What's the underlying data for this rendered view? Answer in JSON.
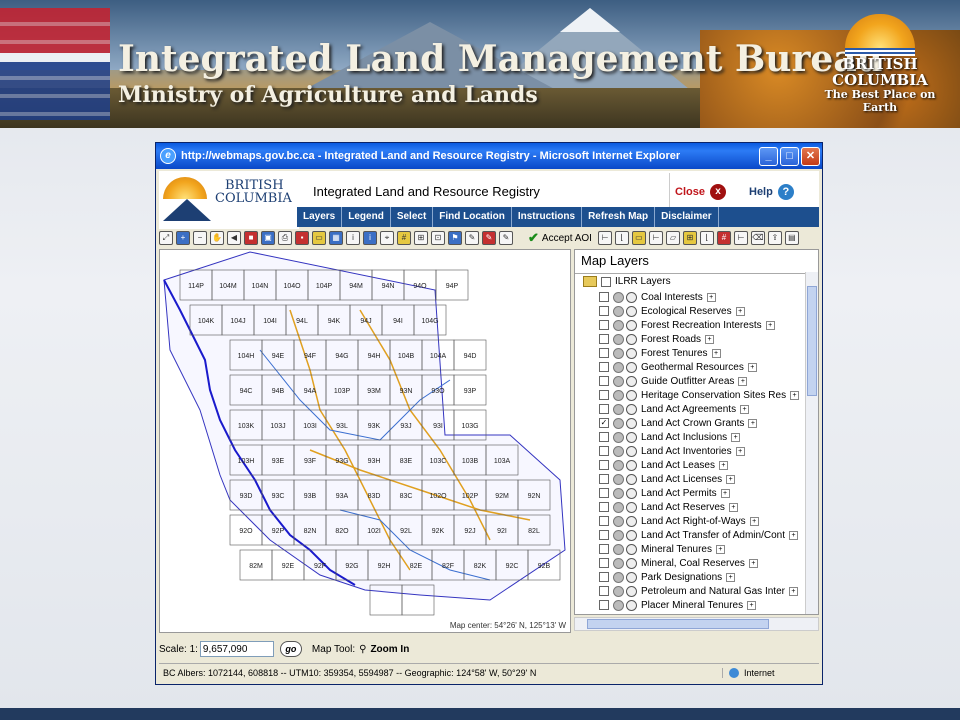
{
  "banner": {
    "title": "Integrated Land Management Bureau",
    "subtitle": "Ministry of Agriculture and Lands",
    "logo_line1": "BRITISH",
    "logo_line2": "COLUMBIA",
    "logo_tagline": "The Best Place on Earth"
  },
  "browser": {
    "title": "http://webmaps.gov.bc.ca - Integrated Land and Resource Registry - Microsoft Internet Explorer",
    "min": "_",
    "max": "□",
    "close": "✕"
  },
  "app": {
    "logo_line1": "BRITISH",
    "logo_line2": "COLUMBIA",
    "title": "Integrated Land and Resource Registry",
    "close_label": "Close",
    "help_label": "Help",
    "menu": [
      "Layers",
      "Legend",
      "Select",
      "Find Location",
      "Instructions",
      "Refresh Map",
      "Disclaimer"
    ]
  },
  "toolbar": {
    "accept_label": "Accept AOI"
  },
  "map": {
    "center_label": "Map center: 54°26' N, 125°13' W",
    "tiles": [
      "114P",
      "104M",
      "104N",
      "104O",
      "104P",
      "94M",
      "94N",
      "94O",
      "94P",
      "104K",
      "104J",
      "104I",
      "94L",
      "94K",
      "94J",
      "94I",
      "104G",
      "104H",
      "94E",
      "94F",
      "94G",
      "94H",
      "104B",
      "104A",
      "94D",
      "94C",
      "94B",
      "94A",
      "103P",
      "93M",
      "93N",
      "93O",
      "93P",
      "103K",
      "103J",
      "103I",
      "93L",
      "93K",
      "93J",
      "93I",
      "103G",
      "103H",
      "93E",
      "93F",
      "93G",
      "93H",
      "83E",
      "103C",
      "103B",
      "103A",
      "93D",
      "93C",
      "93B",
      "93A",
      "83D",
      "83C",
      "102O",
      "102P",
      "92M",
      "92N",
      "92O",
      "92P",
      "82N",
      "82O",
      "102I",
      "92L",
      "92K",
      "92J",
      "92I",
      "82L",
      "82M",
      "92E",
      "92F",
      "92G",
      "92H",
      "82E",
      "82F",
      "82K",
      "92C",
      "92B"
    ]
  },
  "layers": {
    "heading": "Map Layers",
    "root": "ILRR Layers",
    "items": [
      {
        "name": "Coal Interests",
        "checked": false
      },
      {
        "name": "Ecological Reserves",
        "checked": false
      },
      {
        "name": "Forest Recreation Interests",
        "checked": false
      },
      {
        "name": "Forest Roads",
        "checked": false
      },
      {
        "name": "Forest Tenures",
        "checked": false
      },
      {
        "name": "Geothermal Resources",
        "checked": false
      },
      {
        "name": "Guide Outfitter Areas",
        "checked": false
      },
      {
        "name": "Heritage Conservation Sites Res",
        "checked": false
      },
      {
        "name": "Land Act Agreements",
        "checked": false
      },
      {
        "name": "Land Act Crown Grants",
        "checked": true
      },
      {
        "name": "Land Act Inclusions",
        "checked": false
      },
      {
        "name": "Land Act Inventories",
        "checked": false
      },
      {
        "name": "Land Act Leases",
        "checked": false
      },
      {
        "name": "Land Act Licenses",
        "checked": false
      },
      {
        "name": "Land Act Permits",
        "checked": false
      },
      {
        "name": "Land Act Reserves",
        "checked": false
      },
      {
        "name": "Land Act Right-of-Ways",
        "checked": false
      },
      {
        "name": "Land Act Transfer of Admin/Cont",
        "checked": false
      },
      {
        "name": "Mineral Tenures",
        "checked": false
      },
      {
        "name": "Mineral, Coal Reserves",
        "checked": false
      },
      {
        "name": "Park Designations",
        "checked": false
      },
      {
        "name": "Petroleum and Natural Gas Inter",
        "checked": false
      },
      {
        "name": "Placer Mineral Tenures",
        "checked": false
      }
    ]
  },
  "scale": {
    "label": "Scale: 1:",
    "value": "9,657,090",
    "go": "go",
    "tool_label": "Map Tool:",
    "tool_value": "Zoom In"
  },
  "status": {
    "coords": "BC Albers: 1072144, 608818 -- UTM10: 359354, 5594987 -- Geographic: 124°58' W, 50°29' N",
    "zone": "Internet"
  }
}
